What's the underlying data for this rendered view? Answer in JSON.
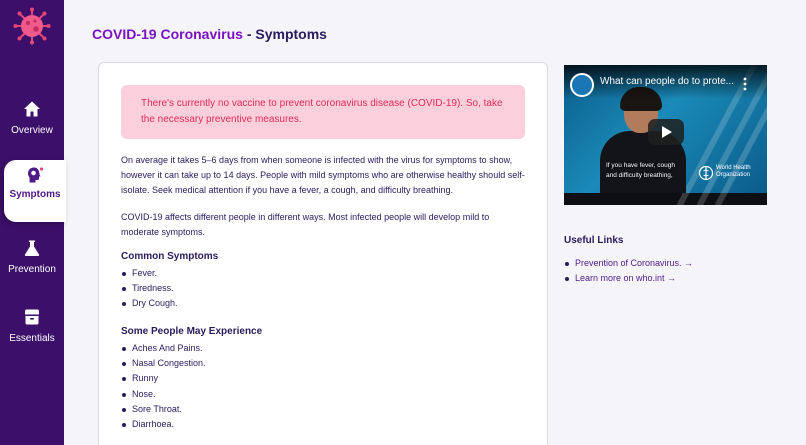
{
  "sidebar": {
    "items": [
      {
        "label": "Overview",
        "icon": "home-icon",
        "active": false
      },
      {
        "label": "Symptoms",
        "icon": "head-virus-icon",
        "active": true
      },
      {
        "label": "Prevention",
        "icon": "flask-icon",
        "active": false
      },
      {
        "label": "Essentials",
        "icon": "box-icon",
        "active": false
      }
    ]
  },
  "header": {
    "title_accent": "COVID-19 Coronavirus",
    "title_rest": " - Symptoms"
  },
  "main": {
    "alert": "There's currently no vaccine to prevent coronavirus disease (COVID-19). So, take the necessary preventive measures.",
    "intro": "On average it takes 5–6 days from when someone is infected with the virus for symptoms to show, however it can take up to 14 days. People with mild symptoms who are otherwise healthy should self-isolate. Seek medical attention if you have a fever, a cough, and difficulty breathing.",
    "affects": "COVID-19 affects different people in different ways. Most infected people will develop mild to moderate symptoms.",
    "common_title": "Common Symptoms",
    "common": [
      "Fever.",
      "Tiredness.",
      "Dry Cough."
    ],
    "some_title": "Some People May Experience",
    "some": [
      "Aches And Pains.",
      "Nasal Congestion.",
      "Runny",
      "Nose.",
      "Sore Throat.",
      "Diarrhoea."
    ]
  },
  "video": {
    "title": "What can people do to prote...",
    "caption_line1": "If you have fever, cough",
    "caption_line2": "and difficulty breathing,",
    "org_line1": "World Health",
    "org_line2": "Organization"
  },
  "useful_links": {
    "title": "Useful Links",
    "links": [
      "Prevention of Coronavirus. →",
      "Learn more on who.int →"
    ]
  },
  "colors": {
    "sidebar": "#3c0f6b",
    "accent": "#7a12c2",
    "alert_bg": "#fbd0dc",
    "alert_text": "#e22a5a"
  }
}
